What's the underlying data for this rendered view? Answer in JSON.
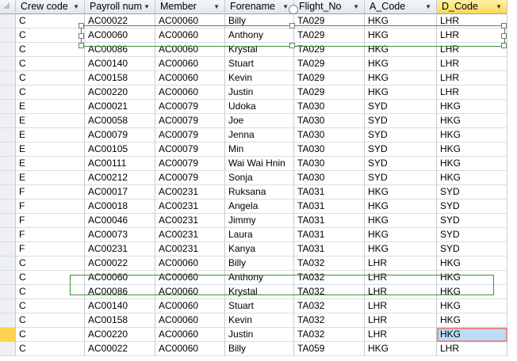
{
  "columns": [
    "Crew code",
    "Payroll num",
    "Member",
    "Forename",
    "Flight_No",
    "A_Code",
    "D_Code"
  ],
  "rows": [
    [
      "C",
      "AC00022",
      "AC00060",
      "Billy",
      "TA029",
      "HKG",
      "LHR"
    ],
    [
      "C",
      "AC00060",
      "AC00060",
      "Anthony",
      "TA029",
      "HKG",
      "LHR"
    ],
    [
      "C",
      "AC00086",
      "AC00060",
      "Krystal",
      "TA029",
      "HKG",
      "LHR"
    ],
    [
      "C",
      "AC00140",
      "AC00060",
      "Stuart",
      "TA029",
      "HKG",
      "LHR"
    ],
    [
      "C",
      "AC00158",
      "AC00060",
      "Kevin",
      "TA029",
      "HKG",
      "LHR"
    ],
    [
      "C",
      "AC00220",
      "AC00060",
      "Justin",
      "TA029",
      "HKG",
      "LHR"
    ],
    [
      "E",
      "AC00021",
      "AC00079",
      "Udoka",
      "TA030",
      "SYD",
      "HKG"
    ],
    [
      "E",
      "AC00058",
      "AC00079",
      "Joe",
      "TA030",
      "SYD",
      "HKG"
    ],
    [
      "E",
      "AC00079",
      "AC00079",
      "Jenna",
      "TA030",
      "SYD",
      "HKG"
    ],
    [
      "E",
      "AC00105",
      "AC00079",
      "Min",
      "TA030",
      "SYD",
      "HKG"
    ],
    [
      "E",
      "AC00111",
      "AC00079",
      "Wai Wai Hnin",
      "TA030",
      "SYD",
      "HKG"
    ],
    [
      "E",
      "AC00212",
      "AC00079",
      "Sonja",
      "TA030",
      "SYD",
      "HKG"
    ],
    [
      "F",
      "AC00017",
      "AC00231",
      "Ruksana",
      "TA031",
      "HKG",
      "SYD"
    ],
    [
      "F",
      "AC00018",
      "AC00231",
      "Angela",
      "TA031",
      "HKG",
      "SYD"
    ],
    [
      "F",
      "AC00046",
      "AC00231",
      "Jimmy",
      "TA031",
      "HKG",
      "SYD"
    ],
    [
      "F",
      "AC00073",
      "AC00231",
      "Laura",
      "TA031",
      "HKG",
      "SYD"
    ],
    [
      "F",
      "AC00231",
      "AC00231",
      "Kanya",
      "TA031",
      "HKG",
      "SYD"
    ],
    [
      "C",
      "AC00022",
      "AC00060",
      "Billy",
      "TA032",
      "LHR",
      "HKG"
    ],
    [
      "C",
      "AC00060",
      "AC00060",
      "Anthony",
      "TA032",
      "LHR",
      "HKG"
    ],
    [
      "C",
      "AC00086",
      "AC00060",
      "Krystal",
      "TA032",
      "LHR",
      "HKG"
    ],
    [
      "C",
      "AC00140",
      "AC00060",
      "Stuart",
      "TA032",
      "LHR",
      "HKG"
    ],
    [
      "C",
      "AC00158",
      "AC00060",
      "Kevin",
      "TA032",
      "LHR",
      "HKG"
    ],
    [
      "C",
      "AC00220",
      "AC00060",
      "Justin",
      "TA032",
      "LHR",
      "HKG"
    ],
    [
      "C",
      "AC00022",
      "AC00060",
      "Billy",
      "TA059",
      "HKG",
      "LHR"
    ]
  ],
  "sorted_column": "D_Code",
  "current_row": 22,
  "active_column": 6,
  "colors": {
    "header_sorted": "#f9d858",
    "active_cell": "#bcdcf8",
    "highlight_box": "#3f8f3f",
    "current_row_marker": "#ffd34d"
  }
}
